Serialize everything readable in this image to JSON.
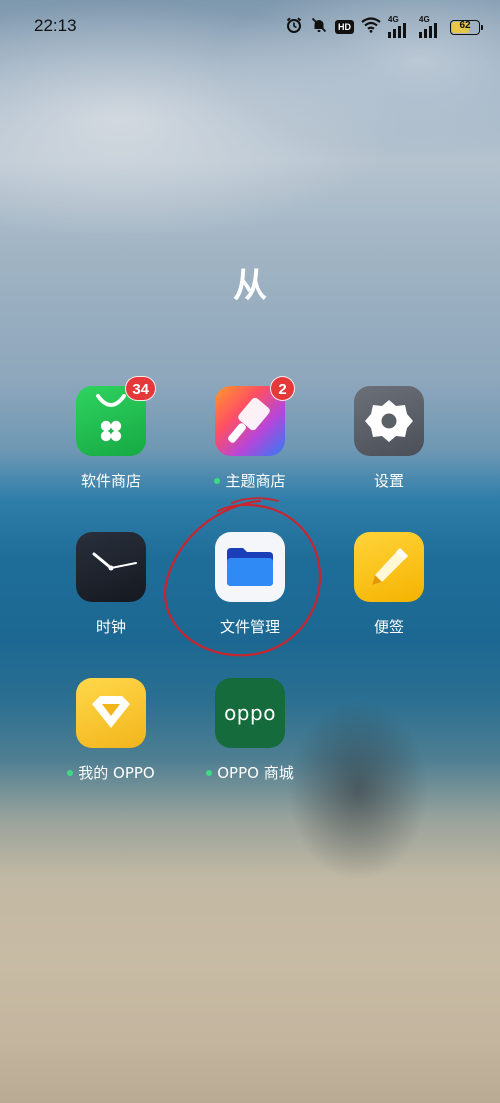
{
  "status_bar": {
    "time": "22:13",
    "network_label_1": "4G",
    "network_label_2": "4G",
    "hd_label": "HD",
    "battery_level": "62",
    "icons": [
      "alarm-icon",
      "mute-bell-icon",
      "hd-icon",
      "wifi-icon",
      "signal-icon",
      "signal-icon",
      "battery-icon"
    ]
  },
  "folder": {
    "title": "从",
    "apps": [
      {
        "label": "软件商店",
        "badge": "34",
        "dot": false,
        "icon": "software-store-icon",
        "color": "#1fbf4f"
      },
      {
        "label": "主题商店",
        "badge": "2",
        "dot": true,
        "icon": "theme-store-icon",
        "color": "#f2543d"
      },
      {
        "label": "设置",
        "badge": "",
        "dot": false,
        "icon": "settings-icon",
        "color": "#5b5f66"
      },
      {
        "label": "时钟",
        "badge": "",
        "dot": false,
        "icon": "clock-icon",
        "color": "#1a1f29"
      },
      {
        "label": "文件管理",
        "badge": "",
        "dot": false,
        "icon": "file-manager-icon",
        "color": "#1e6cf0"
      },
      {
        "label": "便签",
        "badge": "",
        "dot": false,
        "icon": "notes-icon",
        "color": "#f9c40f"
      },
      {
        "label": "我的 OPPO",
        "badge": "",
        "dot": true,
        "icon": "my-oppo-icon",
        "color": "#f3c431"
      },
      {
        "label": "OPPO 商城",
        "badge": "",
        "dot": true,
        "icon": "oppo-store-icon",
        "color": "#166b3c",
        "logo_text": "oppo"
      }
    ]
  },
  "annotation": {
    "type": "hand-drawn red circle",
    "target": "文件管理",
    "color": "#c8252f"
  }
}
